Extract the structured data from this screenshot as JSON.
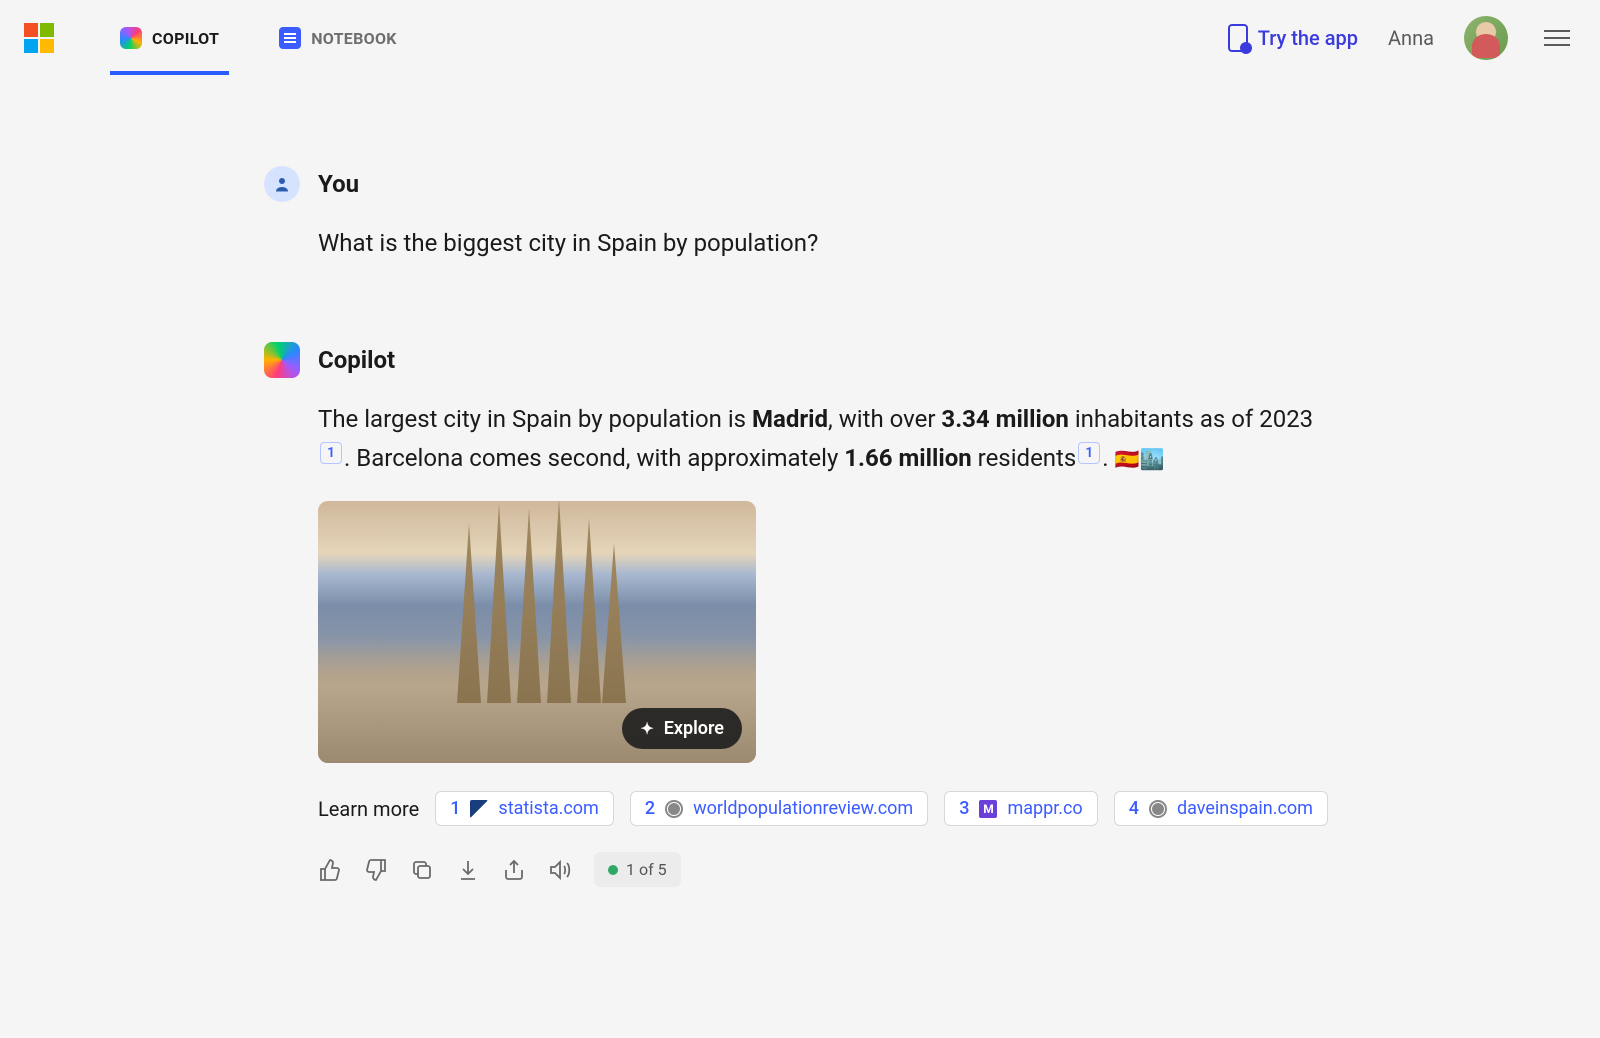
{
  "header": {
    "tabs": [
      {
        "label": "COPILOT",
        "active": true
      },
      {
        "label": "NOTEBOOK",
        "active": false
      }
    ],
    "tryApp": "Try the app",
    "userName": "Anna"
  },
  "conversation": {
    "user": {
      "sender": "You",
      "text": "What is the biggest city in Spain by population?"
    },
    "assistant": {
      "sender": "Copilot",
      "text1": "The largest city in Spain by population is ",
      "bold1": "Madrid",
      "text2": ", with over ",
      "bold2": "3.34 million",
      "text3": " inhabitants as of 2023",
      "cite1": "1",
      "text4": ". Barcelona comes second, with approximately ",
      "bold3": "1.66 million",
      "text5": " residents",
      "cite2": "1",
      "text6": ". ",
      "emoji": "🇪🇸🏙️"
    }
  },
  "image": {
    "exploreLabel": "Explore"
  },
  "learnMore": {
    "label": "Learn more",
    "sources": [
      {
        "num": "1",
        "domain": "statista.com",
        "ico": "statista"
      },
      {
        "num": "2",
        "domain": "worldpopulationreview.com",
        "ico": "globe"
      },
      {
        "num": "3",
        "domain": "mappr.co",
        "ico": "m"
      },
      {
        "num": "4",
        "domain": "daveinspain.com",
        "ico": "globe"
      }
    ]
  },
  "counter": "1 of 5"
}
